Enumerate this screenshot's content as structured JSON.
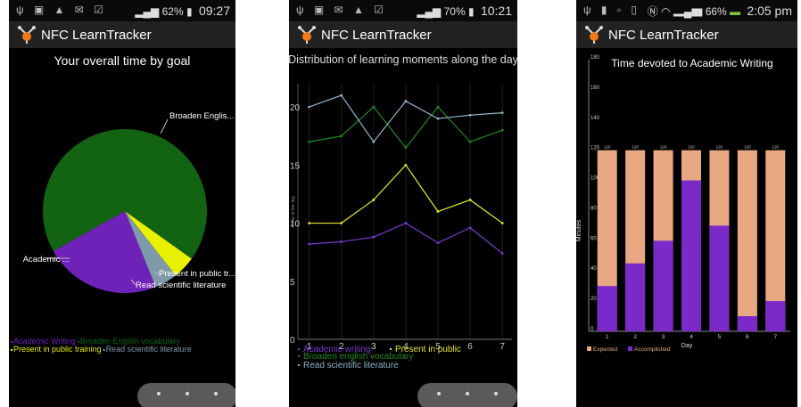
{
  "app": {
    "title": "NFC LearnTracker"
  },
  "screens": [
    {
      "status": {
        "battery": "62%",
        "time": "09:27"
      },
      "chart_data": {
        "type": "pie",
        "title": "Your overall time by goal",
        "slices": [
          {
            "label": "Broaden Englis...",
            "legend": "Broaden English vocabulary",
            "value": 68,
            "color": "#126412"
          },
          {
            "label": "Academic ...",
            "legend": "Academic Writing",
            "value": 23,
            "color": "#6e22b8"
          },
          {
            "label": "Read scientific literature",
            "legend": "Read scientific literature",
            "value": 4.5,
            "color": "#7f9aa8"
          },
          {
            "label": "Present in public tr...",
            "legend": "Present in public training",
            "value": 4.5,
            "color": "#e8f000"
          }
        ]
      }
    },
    {
      "status": {
        "battery": "70%",
        "time": "10:21"
      },
      "chart_data": {
        "type": "line",
        "title": "Distribution of learning moments along the day",
        "ylabel": "Time of the day",
        "x": [
          1,
          2,
          3,
          4,
          5,
          6,
          7
        ],
        "y_ticks": [
          "20",
          "15",
          "10",
          "5",
          "0"
        ],
        "ylim": [
          0,
          22
        ],
        "series": [
          {
            "name": "Academic writing",
            "color": "#7a3bd1",
            "values": [
              8.2,
              8.4,
              8.8,
              10.0,
              8.3,
              9.6,
              7.4
            ]
          },
          {
            "name": "Present in public",
            "color": "#e4e832",
            "values": [
              10.0,
              10.0,
              12.0,
              15.0,
              11.0,
              12.0,
              10.0
            ]
          },
          {
            "name": "Broaden english vocabulary",
            "color": "#1f8a1f",
            "values": [
              17.0,
              17.5,
              20.0,
              16.5,
              20.0,
              17.0,
              18.0
            ]
          },
          {
            "name": "Read scientific literature",
            "color": "#8fb4c8",
            "values": [
              20.0,
              21.0,
              17.0,
              20.5,
              19.0,
              19.3,
              19.5
            ]
          }
        ]
      }
    },
    {
      "status": {
        "battery": "66%",
        "time": "2:05 pm"
      },
      "chart_data": {
        "type": "bar",
        "title": "Time devoted to Academic Writing",
        "xlabel": "Day",
        "ylabel": "Minutes",
        "ylim": [
          0,
          180
        ],
        "y_ticks": [
          "0",
          "20",
          "40",
          "60",
          "80",
          "100",
          "120",
          "140",
          "160",
          "180"
        ],
        "categories": [
          "1",
          "2",
          "3",
          "4",
          "5",
          "6",
          "7"
        ],
        "series": [
          {
            "name": "Expected",
            "color": "#e8a882",
            "values": [
              120,
              120,
              120,
              120,
              120,
              120,
              120
            ]
          },
          {
            "name": "Accomplished",
            "color": "#7a2ac8",
            "values": [
              30,
              45,
              60,
              100,
              70,
              10,
              20
            ]
          }
        ]
      }
    }
  ]
}
